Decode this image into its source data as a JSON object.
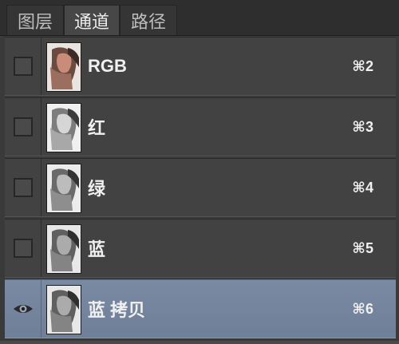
{
  "tabs": [
    {
      "label": "图层"
    },
    {
      "label": "通道"
    },
    {
      "label": "路径"
    }
  ],
  "channels": [
    {
      "name": "RGB",
      "shortcut": "⌘2",
      "visible": false,
      "thumbnail": "color"
    },
    {
      "name": "红",
      "shortcut": "⌘3",
      "visible": false,
      "thumbnail": "grayscale"
    },
    {
      "name": "绿",
      "shortcut": "⌘4",
      "visible": false,
      "thumbnail": "grayscale"
    },
    {
      "name": "蓝",
      "shortcut": "⌘5",
      "visible": false,
      "thumbnail": "grayscale"
    },
    {
      "name": "蓝 拷贝",
      "shortcut": "⌘6",
      "visible": true,
      "selected": true,
      "thumbnail": "grayscale"
    }
  ],
  "colors": {
    "selected_row": "#75859e",
    "panel_bg": "#424242"
  }
}
